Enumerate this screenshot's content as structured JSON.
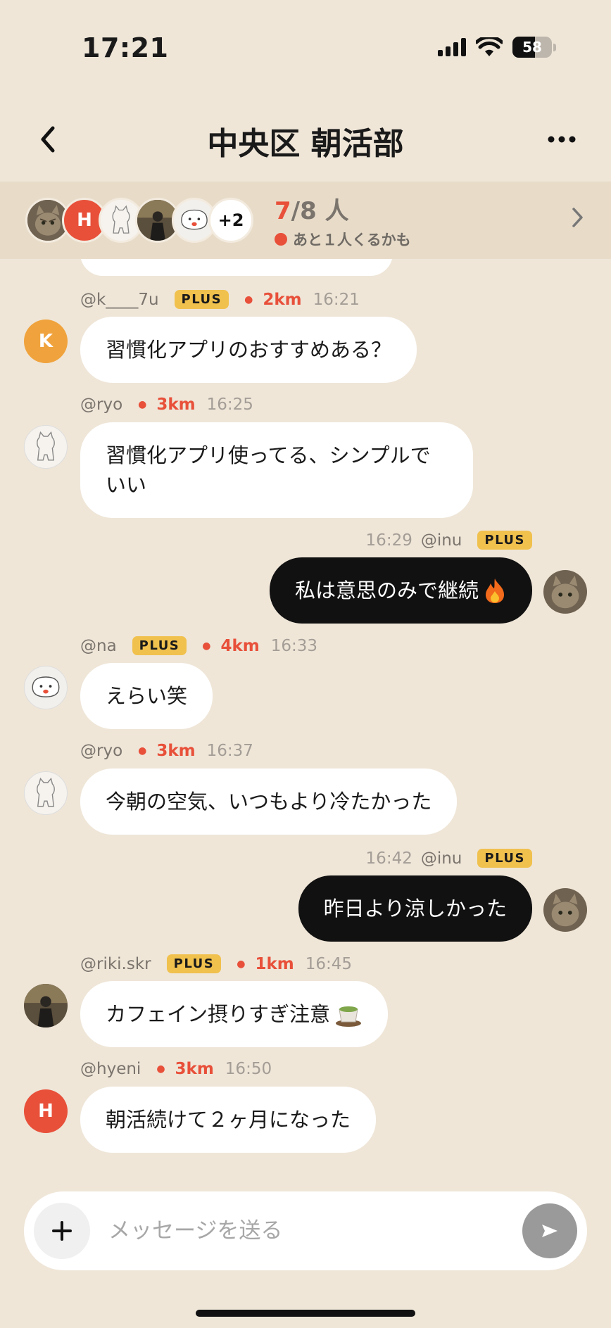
{
  "status": {
    "time": "17:21",
    "battery": "58"
  },
  "header": {
    "title": "中央区 朝活部"
  },
  "members": {
    "avatar_initial": "H",
    "more": "+2",
    "present": "7",
    "total": "/8",
    "unit": "人",
    "note": "あと１人くるかも"
  },
  "messages": [
    {
      "handle": "@k____7u",
      "badge": "PLUS",
      "distance": "2km",
      "time": "16:21",
      "text": "習慣化アプリのおすすめある？",
      "initial": "K"
    },
    {
      "handle": "@ryo",
      "distance": "3km",
      "time": "16:25",
      "text_line1": "習慣化アプリ使ってる、シンプルで",
      "text_line2": "いい"
    },
    {
      "mine": true,
      "handle": "@inu",
      "badge": "PLUS",
      "time": "16:29",
      "text": "私は意思のみで継続"
    },
    {
      "handle": "@na",
      "badge": "PLUS",
      "distance": "4km",
      "time": "16:33",
      "text": "えらい笑"
    },
    {
      "handle": "@ryo",
      "distance": "3km",
      "time": "16:37",
      "text": "今朝の空気、いつもより冷たかった"
    },
    {
      "mine": true,
      "handle": "@inu",
      "badge": "PLUS",
      "time": "16:42",
      "text": "昨日より涼しかった"
    },
    {
      "handle": "@riki.skr",
      "badge": "PLUS",
      "distance": "1km",
      "time": "16:45",
      "text": "カフェイン摂りすぎ注意"
    },
    {
      "handle": "@hyeni",
      "distance": "3km",
      "time": "16:50",
      "text": "朝活続けて２ヶ月になった",
      "initial": "H"
    }
  ],
  "composer": {
    "placeholder": "メッセージを送る"
  },
  "icons": {
    "back": "chevron-left-icon",
    "more": "more-horizontal-icon",
    "chevron": "chevron-right-icon",
    "plus": "plus-icon",
    "send": "send-icon"
  },
  "colors": {
    "background": "#efe6d8",
    "accent": "#e8503a",
    "badge": "#f1c14e",
    "own_bubble": "#111111"
  }
}
